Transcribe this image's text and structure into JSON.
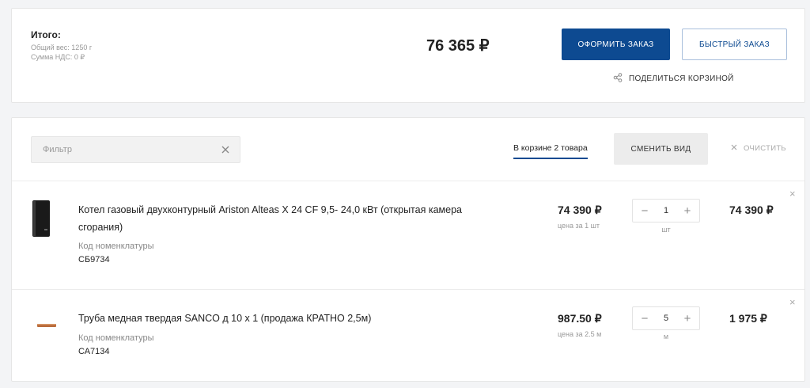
{
  "summary": {
    "title": "Итого:",
    "weight": "Общий вес: 1250 г",
    "vat": "Сумма НДС: 0 ₽",
    "total": "76 365 ₽",
    "checkout_label": "ОФОРМИТЬ ЗАКАЗ",
    "quick_order_label": "БЫСТРЫЙ ЗАКАЗ",
    "share_label": "ПОДЕЛИТЬСЯ КОРЗИНОЙ"
  },
  "cart": {
    "filter_placeholder": "Фильтр",
    "count_label": "В корзине 2 товара",
    "change_view_label": "СМЕНИТЬ ВИД",
    "clear_label": "ОЧИСТИТЬ",
    "items": [
      {
        "name": "Котел газовый двухконтурный Ariston Alteas X 24 CF 9,5- 24,0 кВт (открытая камера сгорания)",
        "code_label": "Код номенклатуры",
        "code": "СБ9734",
        "price": "74 390 ₽",
        "unit_price_label": "цена за 1 шт",
        "quantity": "1",
        "unit": "шт",
        "total": "74 390 ₽",
        "icon": "boiler-image"
      },
      {
        "name": "Труба медная твердая SANCO д 10 х 1 (продажа КРАТНО 2,5м)",
        "code_label": "Код номенклатуры",
        "code": "СА7134",
        "price": "987.50 ₽",
        "unit_price_label": "цена за 2.5 м",
        "quantity": "5",
        "unit": "м",
        "total": "1 975 ₽",
        "icon": "copper-pipe-image"
      }
    ]
  },
  "colors": {
    "primary": "#0d4a91",
    "background": "#f3f4f6"
  }
}
